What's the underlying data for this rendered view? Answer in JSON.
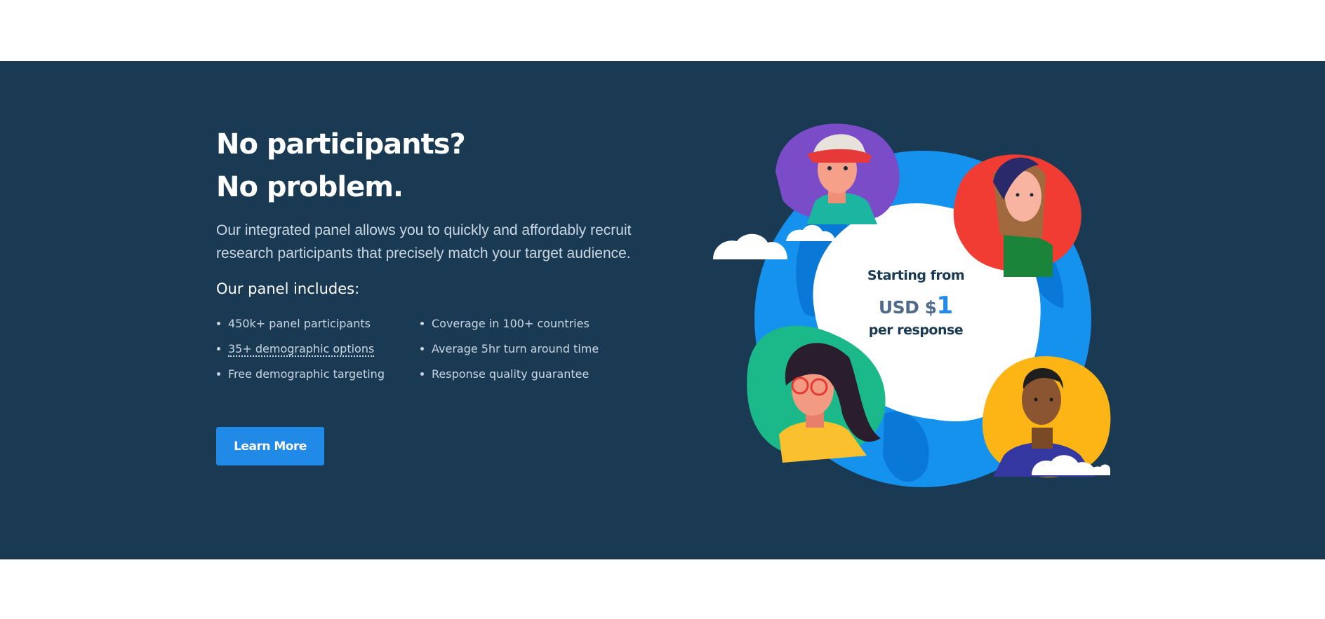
{
  "promo": {
    "headline_line1": "No participants?",
    "headline_line2": "No problem.",
    "description": "Our integrated panel allows you to quickly and affordably recruit research participants that precisely match your target audience.",
    "includes_title": "Our panel includes:",
    "features": [
      "450k+ panel participants",
      "Coverage in 100+ countries",
      "35+ demographic options",
      "Average 5hr turn around time",
      "Free demographic targeting",
      "Response quality guarantee"
    ],
    "cta_label": "Learn More"
  },
  "pricing": {
    "lead": "Starting from",
    "currency": "USD $",
    "amount": "1",
    "tail": "per response"
  },
  "colors": {
    "band_background": "#1a3a53",
    "accent": "#2189e6",
    "text_muted": "#c9d6e3"
  }
}
